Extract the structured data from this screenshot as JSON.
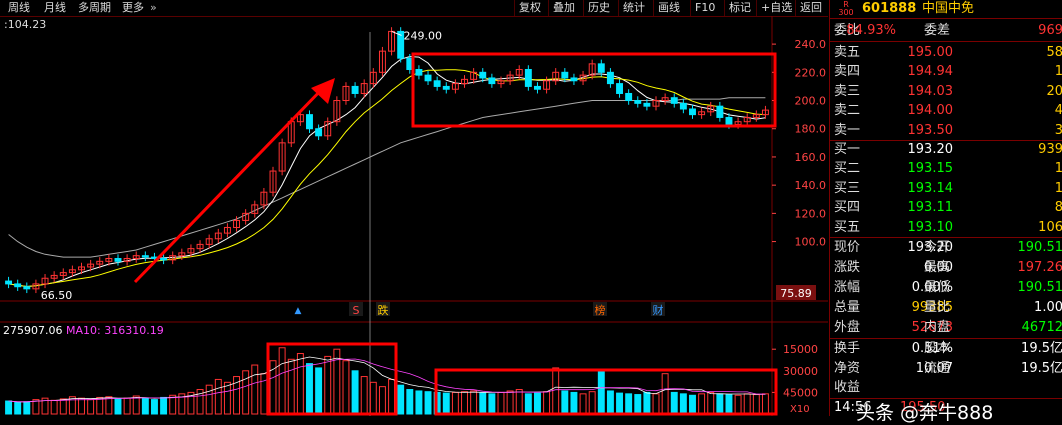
{
  "toolbar": {
    "left_tabs": [
      "周线",
      "月线",
      "多周期",
      "更多"
    ],
    "right_tabs": [
      "复权",
      "叠加",
      "历史",
      "统计",
      "画线",
      "F10",
      "标记",
      "+自选",
      "返回"
    ],
    "close_glyph": "✕"
  },
  "stock": {
    "code": "601888",
    "name": "中国中免",
    "badge_top": "R",
    "badge_bottom": "300"
  },
  "cursor_readout": "104.23",
  "price_axis_ticks": [
    "240.0",
    "220.0",
    "200.0",
    "180.0",
    "160.0",
    "140.0",
    "120.0",
    "100.0"
  ],
  "volume_axis_ticks": [
    "45000",
    "30000",
    "15000"
  ],
  "volume_unit": "X10",
  "ma_header": {
    "prefix": "275907.06",
    "ma10": "MA10: 316310.19"
  },
  "events": [
    {
      "label": "S",
      "color": "#ff4444"
    },
    {
      "label": "跌",
      "color": "#ffcc00"
    },
    {
      "label": "榜",
      "color": "#ff6600"
    },
    {
      "label": "财",
      "color": "#3399ff"
    }
  ],
  "chart_data": {
    "type": "candlestick",
    "title": "",
    "price_range": [
      60,
      250
    ],
    "high_label": "249.00",
    "low_label": "66.50",
    "ma_long_label": "75.89",
    "close": [
      70,
      68,
      66.5,
      70,
      74,
      76,
      78,
      80,
      82,
      84,
      86,
      88,
      86,
      88,
      90,
      89,
      88,
      87,
      90,
      92,
      95,
      98,
      102,
      106,
      110,
      115,
      120,
      126,
      135,
      150,
      170,
      185,
      190,
      180,
      175,
      185,
      200,
      210,
      205,
      212,
      220,
      235,
      249,
      230,
      222,
      218,
      214,
      210,
      208,
      212,
      215,
      220,
      216,
      212,
      214,
      218,
      222,
      210,
      208,
      214,
      220,
      216,
      214,
      218,
      226,
      220,
      212,
      205,
      200,
      198,
      196,
      200,
      202,
      198,
      194,
      190,
      192,
      196,
      188,
      183,
      185,
      188,
      190,
      193.2
    ],
    "ma_long": [
      105,
      100,
      96,
      93,
      91,
      90,
      89,
      89,
      89,
      89,
      90,
      91,
      92,
      93,
      94,
      96,
      98,
      100,
      102,
      104,
      106,
      108,
      110,
      112,
      114,
      116,
      119,
      122,
      125,
      128,
      131,
      134,
      137,
      140,
      143,
      146,
      149,
      152,
      155,
      158,
      161,
      164,
      167,
      170,
      172,
      174,
      176,
      178,
      180,
      182,
      184,
      186,
      188,
      189,
      190,
      191,
      192,
      193,
      194,
      195,
      196,
      197,
      198,
      199,
      200,
      200,
      200,
      200,
      200,
      200,
      200,
      200,
      200,
      200,
      201,
      201,
      201,
      201,
      201,
      202,
      202,
      202,
      202,
      202
    ],
    "volume_ylim": [
      0,
      50000
    ],
    "volume_ticks": [
      15000,
      30000,
      45000
    ],
    "volumes": [
      9000,
      8000,
      8500,
      10000,
      11000,
      9500,
      10500,
      12000,
      11000,
      10000,
      11500,
      12000,
      10500,
      11000,
      12500,
      11000,
      10000,
      11500,
      13000,
      14000,
      15000,
      17000,
      20000,
      24000,
      22000,
      26000,
      30000,
      34000,
      28000,
      37000,
      46000,
      38000,
      42000,
      35000,
      32000,
      40000,
      45000,
      37000,
      30000,
      26000,
      22000,
      19000,
      24000,
      20000,
      17000,
      16000,
      15500,
      15000,
      14500,
      15000,
      15500,
      16000,
      14500,
      14000,
      15000,
      16000,
      17000,
      14000,
      14500,
      15500,
      32000,
      16000,
      15000,
      14000,
      15500,
      30000,
      16000,
      14500,
      14000,
      13500,
      15000,
      14000,
      28000,
      15000,
      14000,
      13000,
      14000,
      15000,
      14000,
      13500,
      13000,
      14000,
      13500,
      14000
    ]
  },
  "annotations": {
    "boxes": [
      "consolidation-box",
      "volume-surge-box",
      "volume-consolidation-box"
    ],
    "arrow": "uptrend-arrow"
  },
  "quote": {
    "commission": {
      "label": "委比",
      "value": "84.93%",
      "label2": "委差",
      "value2": "969"
    },
    "asks": [
      {
        "label": "卖五",
        "price": "195.00",
        "vol": "58"
      },
      {
        "label": "卖四",
        "price": "194.94",
        "vol": "1"
      },
      {
        "label": "卖三",
        "price": "194.03",
        "vol": "20"
      },
      {
        "label": "卖二",
        "price": "194.00",
        "vol": "4"
      },
      {
        "label": "卖一",
        "price": "193.50",
        "vol": "3"
      }
    ],
    "bids": [
      {
        "label": "买一",
        "price": "193.20",
        "vol": "939"
      },
      {
        "label": "买二",
        "price": "193.15",
        "vol": "1"
      },
      {
        "label": "买三",
        "price": "193.14",
        "vol": "1"
      },
      {
        "label": "买四",
        "price": "193.11",
        "vol": "8"
      },
      {
        "label": "买五",
        "price": "193.10",
        "vol": "106"
      }
    ],
    "stats": [
      {
        "l1": "现价",
        "v1": "193.20",
        "c1": "#ffffff",
        "l2": "今开",
        "v2": "190.51",
        "c2": "#00ff00"
      },
      {
        "l1": "涨跌",
        "v1": "0.00",
        "c1": "#ffffff",
        "l2": "最高",
        "v2": "197.26",
        "c2": "#ff3333"
      },
      {
        "l1": "涨幅",
        "v1": "0.00%",
        "c1": "#ffffff",
        "l2": "最低",
        "v2": "190.51",
        "c2": "#00ff00"
      },
      {
        "l1": "总量",
        "v1": "99385",
        "c1": "#ffcc00",
        "l2": "量比",
        "v2": "1.00",
        "c2": "#ffffff"
      },
      {
        "l1": "外盘",
        "v1": "52673",
        "c1": "#ff3333",
        "l2": "内盘",
        "v2": "46712",
        "c2": "#00ff00"
      }
    ],
    "info": [
      {
        "l1": "换手",
        "v1": "0.51%",
        "l2": "股本",
        "v2": "19.5亿"
      },
      {
        "l1": "净资",
        "v1": "10.07",
        "l2": "流通",
        "v2": "19.5亿"
      },
      {
        "l1": "收益",
        "v1": "",
        "l2": "",
        "v2": ""
      }
    ],
    "time": "14:56",
    "last_price": "195.50"
  },
  "colors": {
    "up": "#ff3333",
    "down": "#00e5ff",
    "box": "#ff0000",
    "ma5": "#ffffff",
    "ma10": "#ffff00",
    "ma_long": "#aaaaaa"
  },
  "watermark": "头条 @奔牛888"
}
